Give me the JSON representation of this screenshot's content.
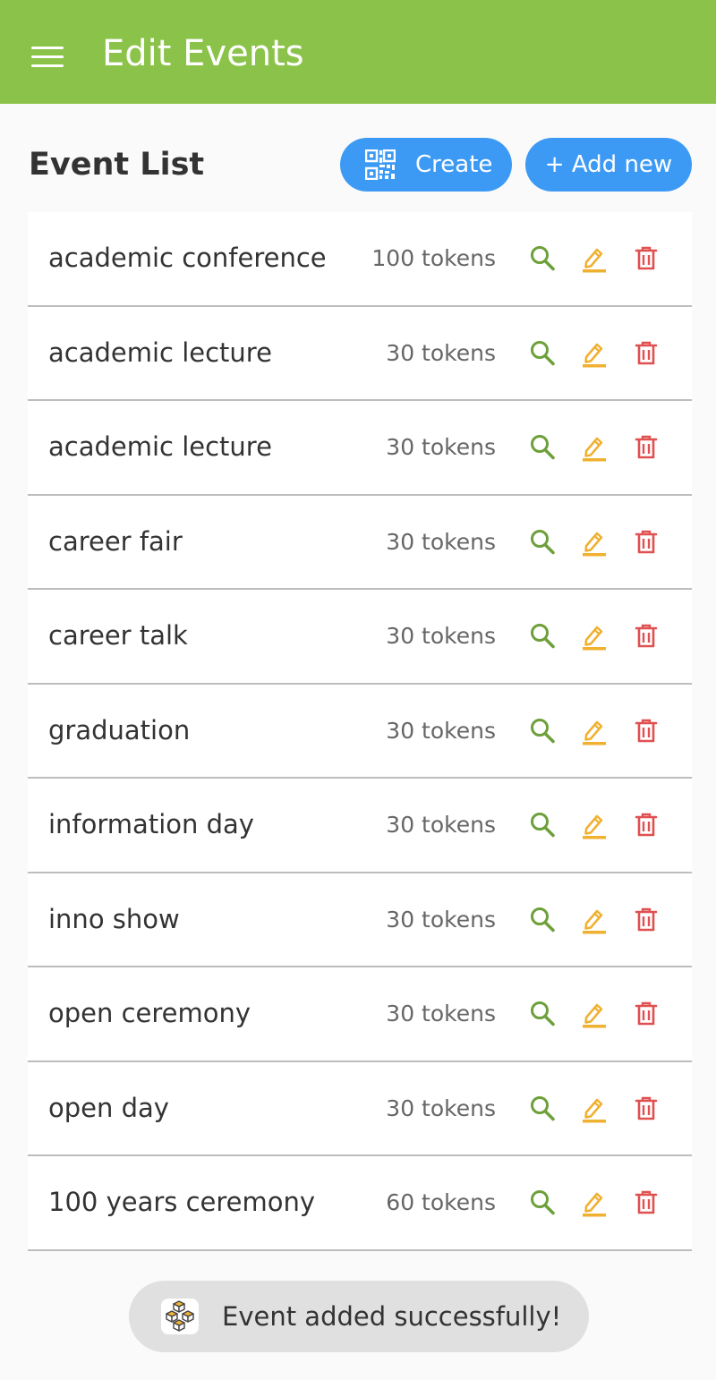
{
  "appbar": {
    "title": "Edit Events"
  },
  "header": {
    "title": "Event List",
    "create_label": "Create",
    "add_label": "+ Add new"
  },
  "events": [
    {
      "name": "academic conference",
      "tokens": "100 tokens"
    },
    {
      "name": "academic lecture",
      "tokens": "30 tokens"
    },
    {
      "name": "academic lecture",
      "tokens": "30 tokens"
    },
    {
      "name": "career fair",
      "tokens": "30 tokens"
    },
    {
      "name": "career talk",
      "tokens": "30 tokens"
    },
    {
      "name": "graduation",
      "tokens": "30 tokens"
    },
    {
      "name": "information day",
      "tokens": "30 tokens"
    },
    {
      "name": "inno show",
      "tokens": "30 tokens"
    },
    {
      "name": "open ceremony",
      "tokens": "30 tokens"
    },
    {
      "name": "open day",
      "tokens": "30 tokens"
    },
    {
      "name": "100 years ceremony",
      "tokens": "60 tokens"
    }
  ],
  "toast": {
    "message": "Event added successfully!"
  },
  "icons": {
    "view": "search-icon",
    "edit": "edit-icon",
    "delete": "trash-icon",
    "create": "qr-code-icon",
    "menu": "menu-icon"
  },
  "colors": {
    "appbar": "#8bc34a",
    "button": "#3d9af4",
    "view": "#6da03a",
    "edit": "#f0b030",
    "delete": "#e05050"
  }
}
